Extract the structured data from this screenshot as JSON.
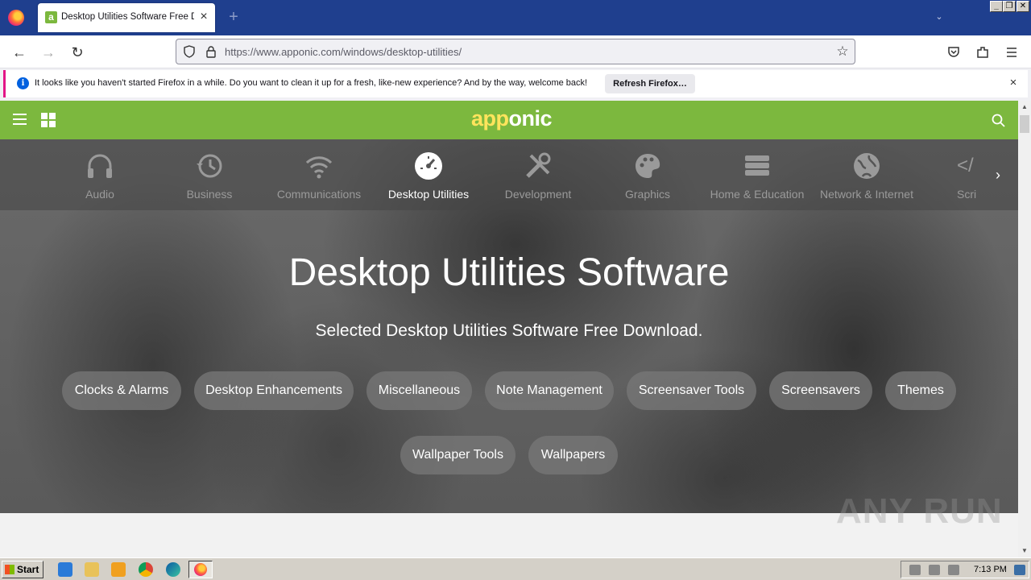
{
  "browser": {
    "tab_title": "Desktop Utilities Software Free Do",
    "tab_favicon": "a",
    "url": "https://www.apponic.com/windows/desktop-utilities/",
    "window_controls": [
      "_",
      "❐",
      "✕"
    ]
  },
  "notification": {
    "message": "It looks like you haven't started Firefox in a while. Do you want to clean it up for a fresh, like-new experience? And by the way, welcome back!",
    "button_label": "Refresh Firefox…"
  },
  "site": {
    "brand_a": "app",
    "brand_b": "onic",
    "brand_color": "#7cb83e",
    "categories": [
      {
        "label": "Audio",
        "icon": "headphones-icon"
      },
      {
        "label": "Business",
        "icon": "history-clock-icon"
      },
      {
        "label": "Communications",
        "icon": "wifi-icon"
      },
      {
        "label": "Desktop Utilities",
        "icon": "speedometer-icon",
        "active": true
      },
      {
        "label": "Development",
        "icon": "tools-icon"
      },
      {
        "label": "Graphics",
        "icon": "palette-icon"
      },
      {
        "label": "Home & Education",
        "icon": "books-icon"
      },
      {
        "label": "Network & Internet",
        "icon": "globe-icon"
      },
      {
        "label": "Scri",
        "icon": "code-icon"
      }
    ],
    "hero_title": "Desktop Utilities Software",
    "hero_subtitle": "Selected Desktop Utilities Software Free Download.",
    "subcategories": [
      "Clocks & Alarms",
      "Desktop Enhancements",
      "Miscellaneous",
      "Note Management",
      "Screensaver Tools",
      "Screensavers",
      "Themes",
      "Wallpaper Tools",
      "Wallpapers"
    ]
  },
  "watermark": "ANY RUN",
  "taskbar": {
    "start_label": "Start",
    "clock": "7:13 PM"
  }
}
